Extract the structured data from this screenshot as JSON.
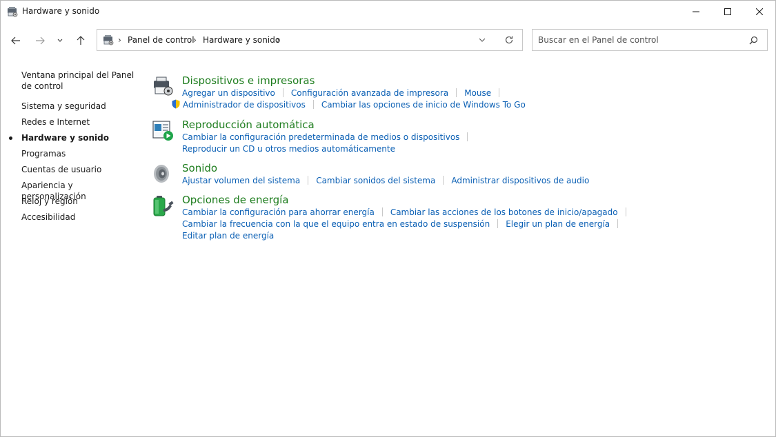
{
  "window": {
    "title": "Hardware y sonido"
  },
  "address": {
    "crumbs": [
      "Panel de control",
      "Hardware y sonido"
    ]
  },
  "search": {
    "placeholder": "Buscar en el Panel de control"
  },
  "sidebar": {
    "items": [
      {
        "label": "Ventana principal del Panel de control",
        "active": false
      },
      {
        "label": "Sistema y seguridad",
        "active": false
      },
      {
        "label": "Redes e Internet",
        "active": false
      },
      {
        "label": "Hardware y sonido",
        "active": true
      },
      {
        "label": "Programas",
        "active": false
      },
      {
        "label": "Cuentas de usuario",
        "active": false
      },
      {
        "label": "Apariencia y personalización",
        "active": false
      },
      {
        "label": "Reloj y región",
        "active": false
      },
      {
        "label": "Accesibilidad",
        "active": false
      }
    ]
  },
  "sections": {
    "devices": {
      "title": "Dispositivos e impresoras",
      "links": [
        "Agregar un dispositivo",
        "Configuración avanzada de impresora",
        "Mouse",
        "Administrador de dispositivos",
        "Cambiar las opciones de inicio de Windows To Go"
      ]
    },
    "autoplay": {
      "title": "Reproducción automática",
      "links": [
        "Cambiar la configuración predeterminada de medios o dispositivos",
        "Reproducir un CD u otros medios automáticamente"
      ]
    },
    "sound": {
      "title": "Sonido",
      "links": [
        "Ajustar volumen del sistema",
        "Cambiar sonidos del sistema",
        "Administrar dispositivos de audio"
      ]
    },
    "power": {
      "title": "Opciones de energía",
      "links": [
        "Cambiar la configuración para ahorrar energía",
        "Cambiar las acciones de los botones de inicio/apagado",
        "Cambiar la frecuencia con la que el equipo entra en estado de suspensión",
        "Elegir un plan de energía",
        "Editar plan de energía"
      ]
    }
  },
  "icons": {
    "app": "control-panel-hardware-icon",
    "back": "arrow-left-icon",
    "forward": "arrow-right-icon",
    "recent": "chevron-down-icon",
    "up": "arrow-up-icon",
    "refresh": "refresh-icon",
    "search": "search-icon",
    "minimize": "minimize-icon",
    "maximize": "maximize-icon",
    "close": "close-icon"
  },
  "colors": {
    "section_title": "#1e7d1e",
    "link": "#0a5fb4"
  }
}
